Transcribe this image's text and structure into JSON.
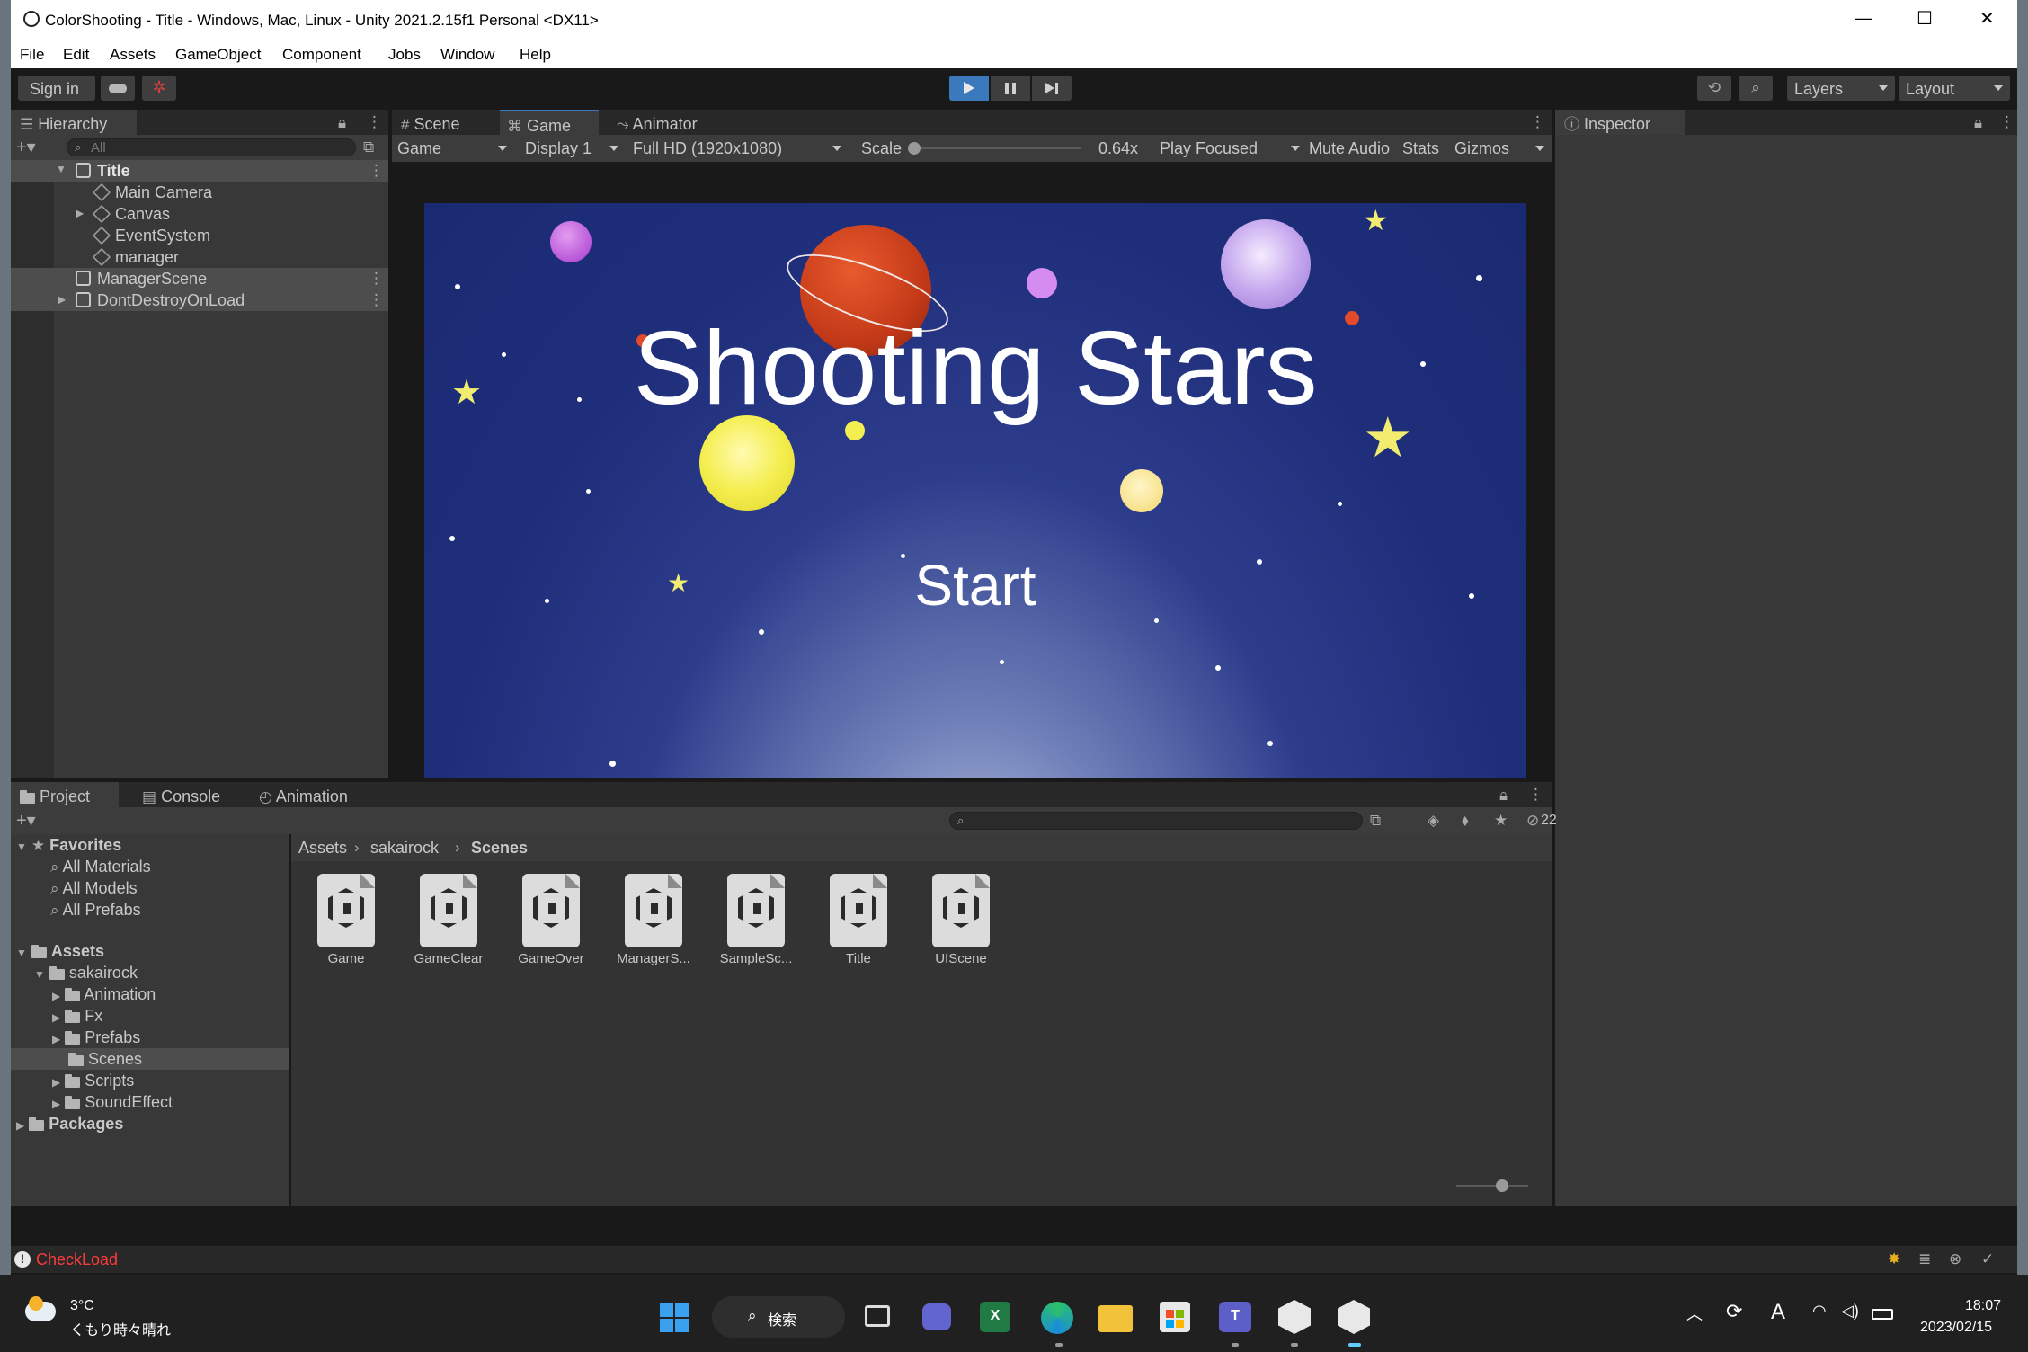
{
  "window": {
    "title": "ColorShooting - Title - Windows, Mac, Linux - Unity 2021.2.15f1 Personal <DX11>",
    "controls": [
      "—",
      "☐",
      "✕"
    ]
  },
  "menu": [
    "File",
    "Edit",
    "Assets",
    "GameObject",
    "Component",
    "Jobs",
    "Window",
    "Help"
  ],
  "toolbar": {
    "sign_in": "Sign in",
    "layers": "Layers",
    "layout": "Layout"
  },
  "hierarchy": {
    "tab": "Hierarchy",
    "search_placeholder": "All",
    "items": [
      {
        "label": "Title",
        "level": 0
      },
      {
        "label": "Main Camera",
        "level": 1
      },
      {
        "label": "Canvas",
        "level": 1
      },
      {
        "label": "EventSystem",
        "level": 1
      },
      {
        "label": "manager",
        "level": 1
      },
      {
        "label": "ManagerScene",
        "level": 0
      },
      {
        "label": "DontDestroyOnLoad",
        "level": 0
      }
    ]
  },
  "view_tabs": [
    "Scene",
    "Game",
    "Animator"
  ],
  "game_bar": {
    "mode": "Game",
    "display": "Display 1",
    "resolution": "Full HD (1920x1080)",
    "scale_label": "Scale",
    "scale_value": "0.64x",
    "play_focused": "Play Focused",
    "mute": "Mute Audio",
    "stats": "Stats",
    "gizmos": "Gizmos"
  },
  "game": {
    "title": "Shooting Stars",
    "start": "Start"
  },
  "inspector": {
    "tab": "Inspector"
  },
  "bottom_tabs": [
    "Project",
    "Console",
    "Animation"
  ],
  "project": {
    "hidden_count": "22",
    "favorites_label": "Favorites",
    "favorites": [
      "All Materials",
      "All Models",
      "All Prefabs"
    ],
    "assets_label": "Assets",
    "sakairock_label": "sakairock",
    "folders": [
      "Animation",
      "Fx",
      "Prefabs",
      "Scenes",
      "Scripts",
      "SoundEffect"
    ],
    "packages_label": "Packages",
    "breadcrumb": [
      "Assets",
      "sakairock",
      "Scenes"
    ],
    "files": [
      "Game",
      "GameClear",
      "GameOver",
      "ManagerS...",
      "SampleSc...",
      "Title",
      "UIScene"
    ]
  },
  "status": {
    "message": "CheckLoad"
  },
  "taskbar": {
    "temp": "3°C",
    "weather": "くもり時々晴れ",
    "search": "検索",
    "time": "18:07",
    "date": "2023/02/15",
    "ime": "A"
  },
  "colors": {
    "unity_bg": "#383838",
    "game_sky": "#1e2e78",
    "error_red": "#ff3a3a",
    "play_blue": "#3a79bb"
  }
}
